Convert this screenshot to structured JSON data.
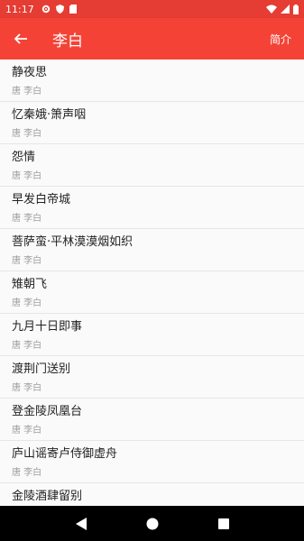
{
  "status_bar": {
    "time": "11:17",
    "left_icons": [
      "gear-icon",
      "shield-icon",
      "sd-card-icon"
    ],
    "right_icons": [
      "wifi-icon",
      "signal-icon",
      "battery-icon"
    ]
  },
  "app_bar": {
    "back_icon": "arrow-back-icon",
    "title": "李白",
    "action_label": "简介",
    "color": "#f44336"
  },
  "poems": [
    {
      "title": "静夜思",
      "subtitle": "唐 李白"
    },
    {
      "title": "忆秦娥·箫声咽",
      "subtitle": "唐 李白"
    },
    {
      "title": "怨情",
      "subtitle": "唐 李白"
    },
    {
      "title": "早发白帝城",
      "subtitle": "唐 李白"
    },
    {
      "title": "菩萨蛮·平林漠漠烟如织",
      "subtitle": "唐 李白"
    },
    {
      "title": "雉朝飞",
      "subtitle": "唐 李白"
    },
    {
      "title": "九月十日即事",
      "subtitle": "唐 李白"
    },
    {
      "title": "渡荆门送别",
      "subtitle": "唐 李白"
    },
    {
      "title": "登金陵凤凰台",
      "subtitle": "唐 李白"
    },
    {
      "title": "庐山谣寄卢侍御虚舟",
      "subtitle": "唐 李白"
    },
    {
      "title": "金陵酒肆留别",
      "subtitle": ""
    }
  ],
  "nav_bar": {
    "buttons": [
      "back-triangle-icon",
      "home-circle-icon",
      "recents-square-icon"
    ]
  }
}
